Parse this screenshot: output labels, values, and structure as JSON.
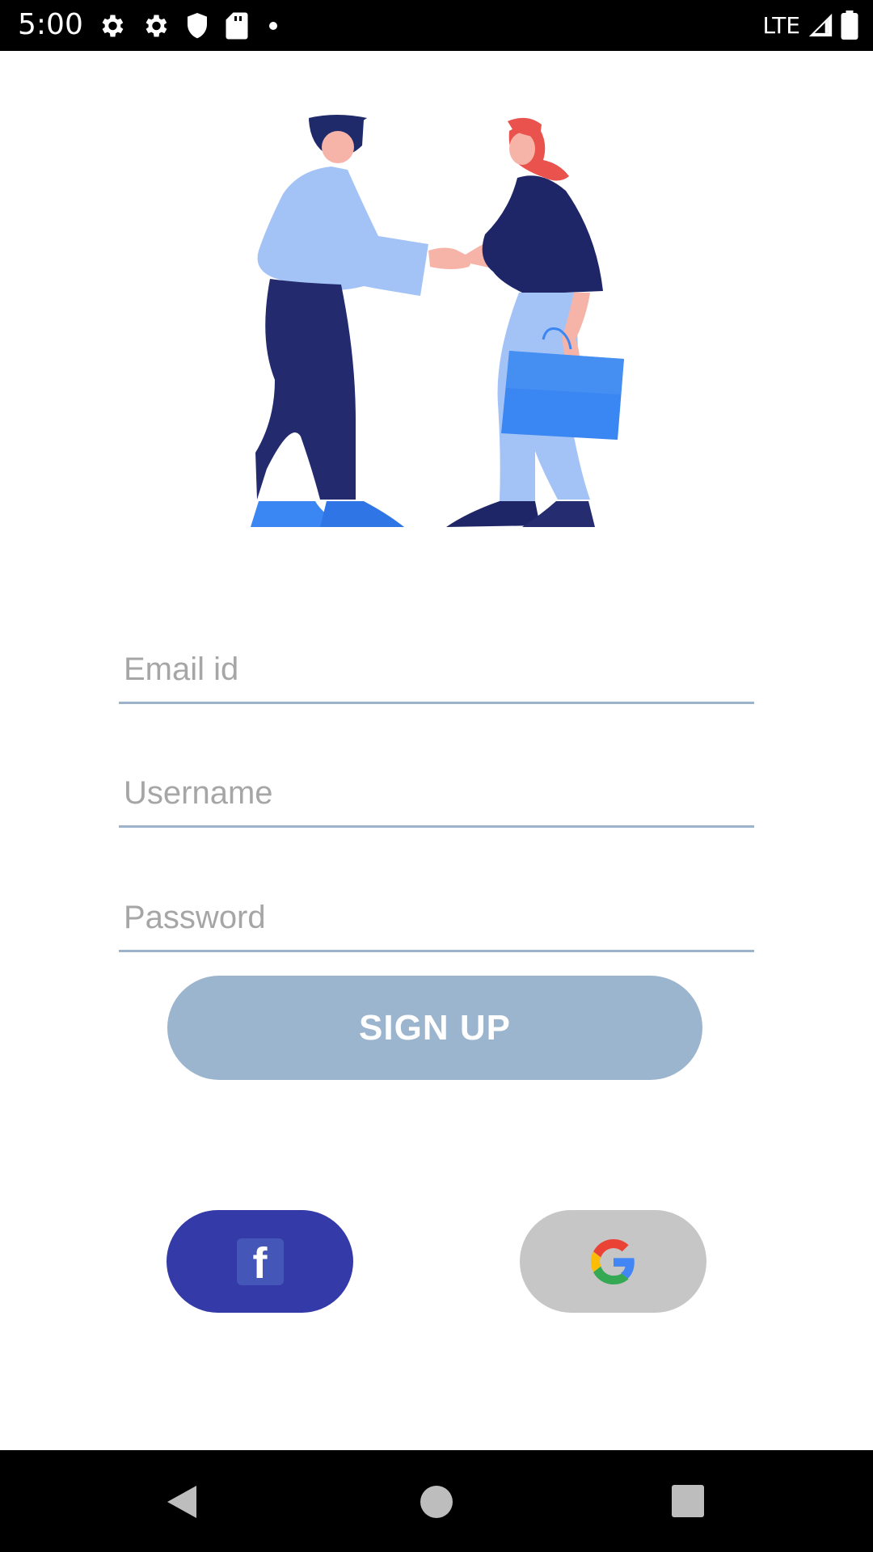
{
  "status_bar": {
    "time": "5:00",
    "network": "LTE",
    "left_icons": [
      "gear-icon",
      "gear-icon",
      "shield-icon",
      "sd-card-icon",
      "dot-icon"
    ],
    "right_icons": [
      "signal-icon",
      "battery-icon"
    ]
  },
  "hero": {
    "icon": "handshake-illustration"
  },
  "form": {
    "email": {
      "placeholder": "Email id",
      "value": ""
    },
    "username": {
      "placeholder": "Username",
      "value": ""
    },
    "password": {
      "placeholder": "Password",
      "value": ""
    },
    "signup_label": "SIGN UP"
  },
  "social": {
    "facebook": {
      "icon": "facebook-icon",
      "glyph": "f",
      "color": "#343ba8"
    },
    "google": {
      "icon": "google-icon",
      "color": "#c6c6c6"
    }
  },
  "colors": {
    "accent": "#9cb5cf",
    "underline": "#9db3cb"
  },
  "nav_bar": {
    "icons": [
      "back-icon",
      "home-icon",
      "recents-icon"
    ]
  }
}
